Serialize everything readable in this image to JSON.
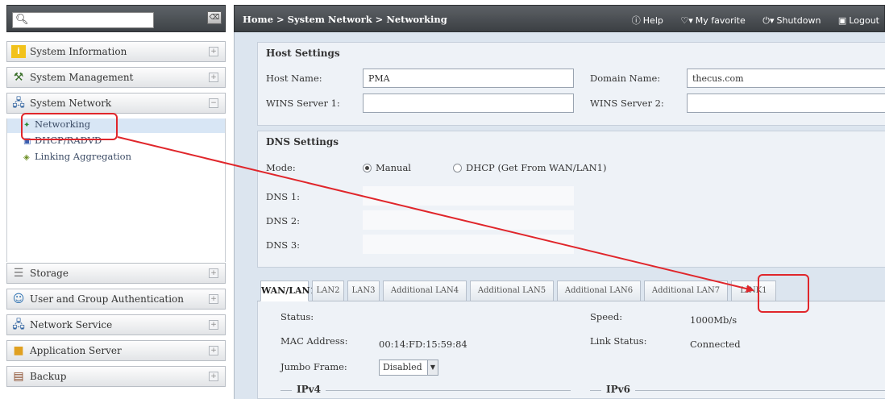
{
  "search": {
    "placeholder": "",
    "value": "",
    "clear_glyph": "⌫"
  },
  "sidebar": {
    "items": [
      {
        "label": "System Information",
        "icon": "info-icon",
        "toggle": "+"
      },
      {
        "label": "System Management",
        "icon": "tools-icon",
        "toggle": "+"
      },
      {
        "label": "System Network",
        "icon": "network-icon",
        "toggle": "−"
      },
      {
        "label": "Storage",
        "icon": "storage-icon",
        "toggle": "+"
      },
      {
        "label": "User and Group Authentication",
        "icon": "users-icon",
        "toggle": "+"
      },
      {
        "label": "Network Service",
        "icon": "service-icon",
        "toggle": "+"
      },
      {
        "label": "Application Server",
        "icon": "app-server-icon",
        "toggle": "+"
      },
      {
        "label": "Backup",
        "icon": "backup-icon",
        "toggle": "+"
      }
    ],
    "sub_items": [
      {
        "label": "Networking",
        "active": true
      },
      {
        "label": "DHCP/RADVD",
        "active": false
      },
      {
        "label": "Linking Aggregation",
        "active": false
      }
    ]
  },
  "topbar": {
    "breadcrumb": [
      "Home",
      "System Network",
      "Networking"
    ],
    "breadcrumb_sep": ">",
    "help": "Help",
    "favorite": "My favorite",
    "shutdown": "Shutdown",
    "logout": "Logout"
  },
  "host_settings": {
    "title": "Host Settings",
    "host_name_label": "Host Name:",
    "host_name_value": "PMA",
    "domain_name_label": "Domain Name:",
    "domain_name_value": "thecus.com",
    "wins1_label": "WINS Server 1:",
    "wins1_value": "",
    "wins2_label": "WINS Server 2:",
    "wins2_value": ""
  },
  "dns_settings": {
    "title": "DNS Settings",
    "mode_label": "Mode:",
    "mode_manual": "Manual",
    "mode_dhcp": "DHCP (Get From WAN/LAN1)",
    "mode_selected": "Manual",
    "dns1_label": "DNS 1:",
    "dns2_label": "DNS 2:",
    "dns3_label": "DNS 3:",
    "dns1_value": "",
    "dns2_value": "",
    "dns3_value": ""
  },
  "tabs": [
    {
      "label": "WAN/LAN1",
      "active": true
    },
    {
      "label": "LAN2",
      "active": false
    },
    {
      "label": "LAN3",
      "active": false
    },
    {
      "label": "Additional LAN4",
      "active": false
    },
    {
      "label": "Additional LAN5",
      "active": false
    },
    {
      "label": "Additional LAN6",
      "active": false
    },
    {
      "label": "Additional LAN7",
      "active": false
    },
    {
      "label": "LINK1",
      "active": false
    }
  ],
  "lan": {
    "status_label": "Status:",
    "status_value": "",
    "speed_label": "Speed:",
    "speed_value": "1000Mb/s",
    "mac_label": "MAC Address:",
    "mac_value": "00:14:FD:15:59:84",
    "link_status_label": "Link Status:",
    "link_status_value": "Connected",
    "jumbo_label": "Jumbo Frame:",
    "jumbo_value": "Disabled",
    "ipv4_title": "IPv4",
    "ipv6_title": "IPv6"
  },
  "annotation_color": "#e0262b"
}
